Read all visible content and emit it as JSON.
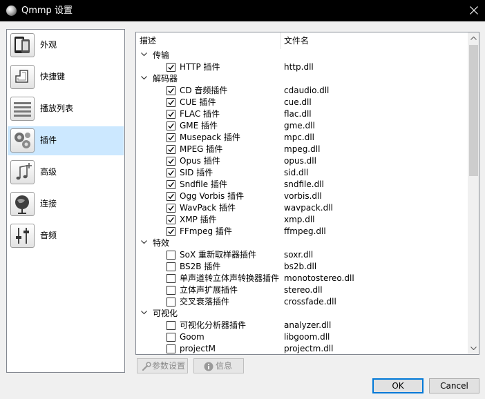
{
  "window": {
    "title": "Qmmp 设置",
    "icon": "qmmp-logo-icon"
  },
  "sidebar": {
    "selected_index": 3,
    "items": [
      {
        "label": "外观",
        "icon": "appearance-icon"
      },
      {
        "label": "快捷键",
        "icon": "shortcuts-icon"
      },
      {
        "label": "播放列表",
        "icon": "playlist-icon"
      },
      {
        "label": "插件",
        "icon": "plugins-icon"
      },
      {
        "label": "高级",
        "icon": "advanced-icon"
      },
      {
        "label": "连接",
        "icon": "connection-icon"
      },
      {
        "label": "音频",
        "icon": "audio-icon"
      }
    ]
  },
  "tree": {
    "columns": [
      "描述",
      "文件名"
    ],
    "rows": [
      {
        "type": "group",
        "label": "传输",
        "expanded": true
      },
      {
        "type": "item",
        "desc": "HTTP 插件",
        "file": "http.dll",
        "checked": true
      },
      {
        "type": "group",
        "label": "解码器",
        "expanded": true
      },
      {
        "type": "item",
        "desc": "CD 音频插件",
        "file": "cdaudio.dll",
        "checked": true
      },
      {
        "type": "item",
        "desc": "CUE 插件",
        "file": "cue.dll",
        "checked": true
      },
      {
        "type": "item",
        "desc": "FLAC 插件",
        "file": "flac.dll",
        "checked": true
      },
      {
        "type": "item",
        "desc": "GME 插件",
        "file": "gme.dll",
        "checked": true
      },
      {
        "type": "item",
        "desc": "Musepack 插件",
        "file": "mpc.dll",
        "checked": true
      },
      {
        "type": "item",
        "desc": "MPEG 插件",
        "file": "mpeg.dll",
        "checked": true
      },
      {
        "type": "item",
        "desc": "Opus 插件",
        "file": "opus.dll",
        "checked": true
      },
      {
        "type": "item",
        "desc": "SID 插件",
        "file": "sid.dll",
        "checked": true
      },
      {
        "type": "item",
        "desc": "Sndfile 插件",
        "file": "sndfile.dll",
        "checked": true
      },
      {
        "type": "item",
        "desc": "Ogg Vorbis 插件",
        "file": "vorbis.dll",
        "checked": true
      },
      {
        "type": "item",
        "desc": "WavPack 插件",
        "file": "wavpack.dll",
        "checked": true
      },
      {
        "type": "item",
        "desc": "XMP 插件",
        "file": "xmp.dll",
        "checked": true
      },
      {
        "type": "item",
        "desc": "FFmpeg 插件",
        "file": "ffmpeg.dll",
        "checked": true
      },
      {
        "type": "group",
        "label": "特效",
        "expanded": true
      },
      {
        "type": "item",
        "desc": "SoX 重新取样器插件",
        "file": "soxr.dll",
        "checked": false
      },
      {
        "type": "item",
        "desc": "BS2B 插件",
        "file": "bs2b.dll",
        "checked": false
      },
      {
        "type": "item",
        "desc": "单声道转立体声转换器插件",
        "file": "monotostereo.dll",
        "checked": false
      },
      {
        "type": "item",
        "desc": "立体声扩展插件",
        "file": "stereo.dll",
        "checked": false
      },
      {
        "type": "item",
        "desc": "交叉衰落插件",
        "file": "crossfade.dll",
        "checked": false
      },
      {
        "type": "group",
        "label": "可视化",
        "expanded": true
      },
      {
        "type": "item",
        "desc": "可视化分析器插件",
        "file": "analyzer.dll",
        "checked": false
      },
      {
        "type": "item",
        "desc": "Goom",
        "file": "libgoom.dll",
        "checked": false
      },
      {
        "type": "item",
        "desc": "projectM",
        "file": "projectm.dll",
        "checked": false
      }
    ]
  },
  "buttons": {
    "preferences": {
      "label": "参数设置",
      "icon": "wrench-icon",
      "enabled": false
    },
    "information": {
      "label": "信息",
      "icon": "info-icon",
      "enabled": false
    },
    "ok": "OK",
    "cancel": "Cancel"
  },
  "colors": {
    "titlebar": "#000000",
    "selection": "#cce8ff",
    "check": "#000000",
    "default_button_border": "#0078d7"
  }
}
